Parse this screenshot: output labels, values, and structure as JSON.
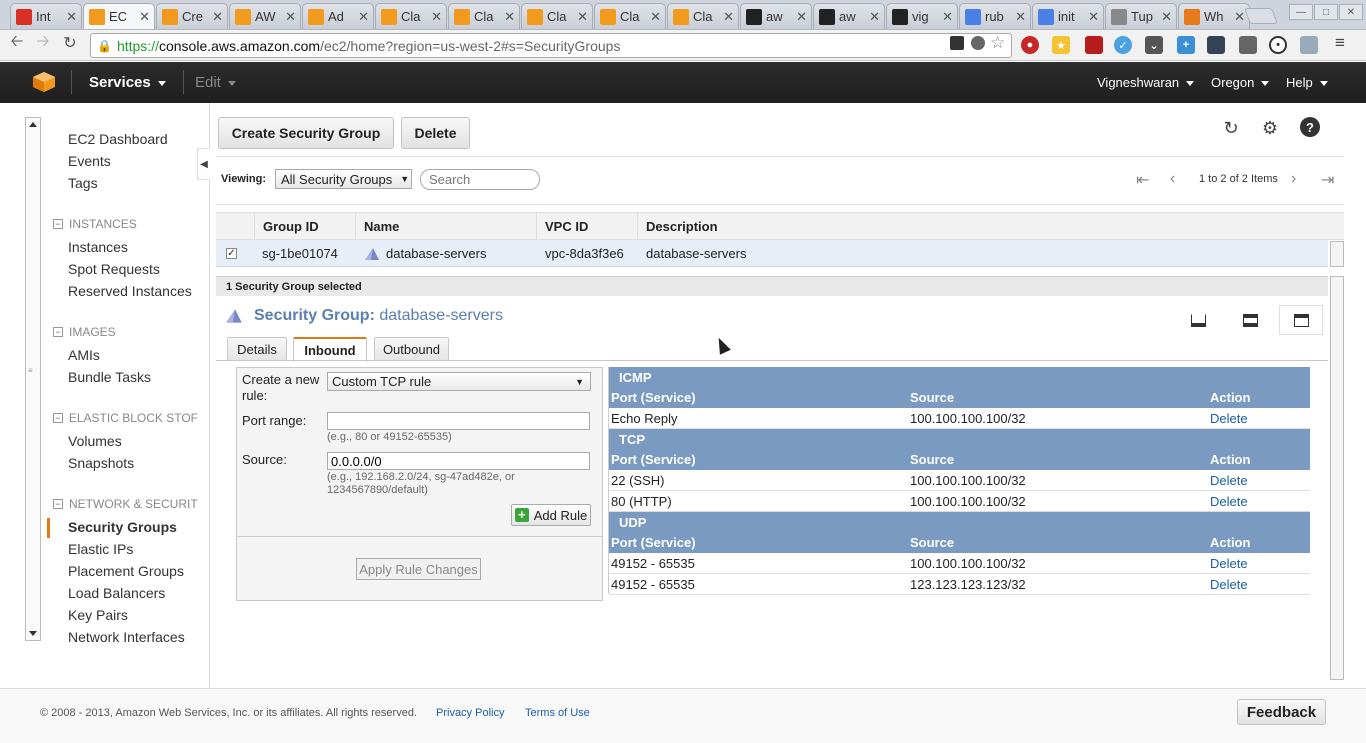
{
  "browser": {
    "tabs": [
      {
        "title": "Int",
        "favicon": "gmail-icon",
        "color": "#d93025"
      },
      {
        "title": "EC",
        "favicon": "aws-icon",
        "color": "#f29a1d"
      },
      {
        "title": "Cre",
        "favicon": "aws-icon",
        "color": "#f29a1d"
      },
      {
        "title": "AW",
        "favicon": "aws-icon",
        "color": "#f29a1d"
      },
      {
        "title": "Ad",
        "favicon": "aws-icon",
        "color": "#f29a1d"
      },
      {
        "title": "Cla",
        "favicon": "aws-icon",
        "color": "#f29a1d"
      },
      {
        "title": "Cla",
        "favicon": "aws-icon",
        "color": "#f29a1d"
      },
      {
        "title": "Cla",
        "favicon": "aws-icon",
        "color": "#f29a1d"
      },
      {
        "title": "Cla",
        "favicon": "aws-icon",
        "color": "#f29a1d"
      },
      {
        "title": "Cla",
        "favicon": "aws-icon",
        "color": "#f29a1d"
      },
      {
        "title": "aw",
        "favicon": "github-icon",
        "color": "#222"
      },
      {
        "title": "aw",
        "favicon": "github-icon",
        "color": "#222"
      },
      {
        "title": "vig",
        "favicon": "github-icon",
        "color": "#222"
      },
      {
        "title": "rub",
        "favicon": "google-icon",
        "color": "#4a7fe5"
      },
      {
        "title": "init",
        "favicon": "google-icon",
        "color": "#4a7fe5"
      },
      {
        "title": "Tup",
        "favicon": "document-icon",
        "color": "#888"
      },
      {
        "title": "Wh",
        "favicon": "stackoverflow-icon",
        "color": "#e8791d"
      }
    ],
    "url": {
      "scheme": "https://",
      "host": "console.aws.amazon.com",
      "path": "/ec2/home?region=us-west-2#s=SecurityGroups"
    }
  },
  "header": {
    "services": "Services",
    "edit": "Edit",
    "user": "Vigneshwaran",
    "region": "Oregon",
    "help": "Help"
  },
  "sidebar": {
    "top": [
      "EC2 Dashboard",
      "Events",
      "Tags"
    ],
    "sections": [
      {
        "title": "INSTANCES",
        "items": [
          "Instances",
          "Spot Requests",
          "Reserved Instances"
        ]
      },
      {
        "title": "IMAGES",
        "items": [
          "AMIs",
          "Bundle Tasks"
        ]
      },
      {
        "title": "ELASTIC BLOCK STOF",
        "items": [
          "Volumes",
          "Snapshots"
        ]
      },
      {
        "title": "NETWORK & SECURIT",
        "items": [
          "Security Groups",
          "Elastic IPs",
          "Placement Groups",
          "Load Balancers",
          "Key Pairs",
          "Network Interfaces"
        ]
      }
    ],
    "active": "Security Groups"
  },
  "toolbar": {
    "create": "Create Security Group",
    "delete": "Delete"
  },
  "filter": {
    "viewing_label": "Viewing:",
    "viewing_value": "All Security Groups",
    "search_placeholder": "Search",
    "pager": "1 to 2 of 2 Items"
  },
  "table": {
    "columns": [
      "Group ID",
      "Name",
      "VPC ID",
      "Description"
    ],
    "rows": [
      {
        "group_id": "sg-1be01074",
        "name": "database-servers",
        "vpc_id": "vpc-8da3f3e6",
        "description": "database-servers",
        "checked": true
      }
    ]
  },
  "detail": {
    "selected_text": "1 Security Group selected",
    "title_label": "Security Group:",
    "title_value": "database-servers",
    "tabs": [
      "Details",
      "Inbound",
      "Outbound"
    ],
    "active_tab": "Inbound"
  },
  "form": {
    "create_label": "Create a new rule:",
    "rule_type": "Custom TCP rule",
    "port_label": "Port range:",
    "port_value": "",
    "port_hint": "(e.g., 80 or 49152-65535)",
    "source_label": "Source:",
    "source_value": "0.0.0.0/0",
    "source_hint": "(e.g., 192.168.2.0/24, sg-47ad482e, or 1234567890/default)",
    "add_rule": "Add Rule",
    "apply": "Apply Rule Changes"
  },
  "rules": {
    "header": {
      "port": "Port (Service)",
      "source": "Source",
      "action": "Action"
    },
    "groups": [
      {
        "name": "ICMP",
        "rows": [
          {
            "port": "Echo Reply",
            "source": "100.100.100.100/32",
            "action": "Delete"
          }
        ]
      },
      {
        "name": "TCP",
        "rows": [
          {
            "port": "22 (SSH)",
            "source": "100.100.100.100/32",
            "action": "Delete"
          },
          {
            "port": "80 (HTTP)",
            "source": "100.100.100.100/32",
            "action": "Delete"
          }
        ]
      },
      {
        "name": "UDP",
        "rows": [
          {
            "port": "49152 - 65535",
            "source": "100.100.100.100/32",
            "action": "Delete"
          },
          {
            "port": "49152 - 65535",
            "source": "123.123.123.123/32",
            "action": "Delete"
          }
        ]
      }
    ]
  },
  "footer": {
    "copyright": "© 2008 - 2013, Amazon Web Services, Inc. or its affiliates. All rights reserved.",
    "privacy": "Privacy Policy",
    "terms": "Terms of Use",
    "feedback": "Feedback"
  }
}
